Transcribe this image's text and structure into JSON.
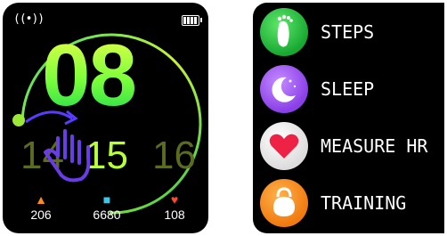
{
  "watch": {
    "hour": "08",
    "dates": {
      "prev": "14",
      "current": "15",
      "next": "16"
    },
    "stats": [
      {
        "icon": "flame-icon",
        "value": "206"
      },
      {
        "icon": "shoe-icon",
        "value": "6680"
      },
      {
        "icon": "heart-icon",
        "value": "108"
      }
    ]
  },
  "menu": {
    "items": [
      {
        "label": "STEPS",
        "icon": "footprint-icon"
      },
      {
        "label": "SLEEP",
        "icon": "moon-icon"
      },
      {
        "label": "MEASURE HR",
        "icon": "heart-icon"
      },
      {
        "label": "TRAINING",
        "icon": "kettlebell-icon"
      }
    ]
  }
}
